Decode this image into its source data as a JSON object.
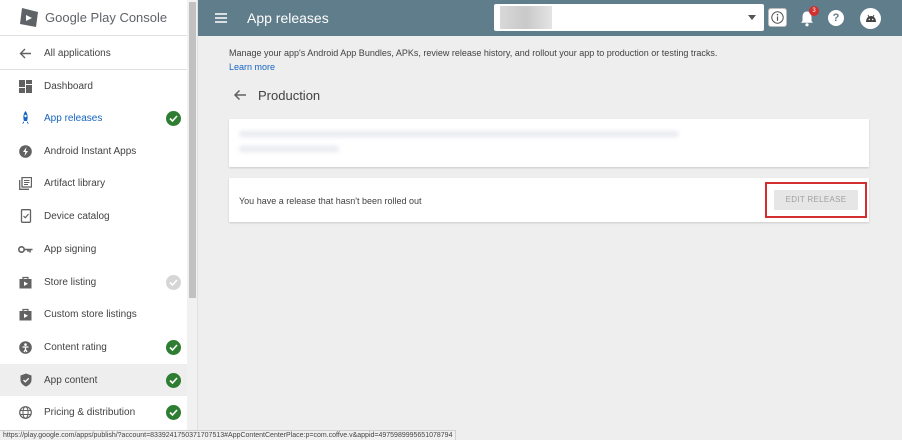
{
  "brand": {
    "name_1": "Google Play",
    "name_2": " Console"
  },
  "nav": {
    "all_applications": "All applications",
    "items": [
      {
        "label": "Dashboard",
        "icon": "dashboard-icon",
        "status": "none"
      },
      {
        "label": "App releases",
        "icon": "rocket-icon",
        "status": "complete",
        "active": true
      },
      {
        "label": "Android Instant Apps",
        "icon": "instant-apps-icon",
        "status": "none"
      },
      {
        "label": "Artifact library",
        "icon": "library-icon",
        "status": "none"
      },
      {
        "label": "Device catalog",
        "icon": "device-icon",
        "status": "none"
      },
      {
        "label": "App signing",
        "icon": "key-icon",
        "status": "none"
      },
      {
        "label": "Store listing",
        "icon": "store-icon",
        "status": "incomplete"
      },
      {
        "label": "Custom store listings",
        "icon": "store-icon",
        "status": "none"
      },
      {
        "label": "Content rating",
        "icon": "rating-icon",
        "status": "complete"
      },
      {
        "label": "App content",
        "icon": "shield-icon",
        "status": "complete"
      },
      {
        "label": "Pricing & distribution",
        "icon": "globe-icon",
        "status": "complete"
      }
    ]
  },
  "topbar": {
    "title": "App releases",
    "notification_count": "3",
    "help_label": "?"
  },
  "main": {
    "description": "Manage your app's Android App Bundles, APKs, review release history, and rollout your app to production or testing tracks.",
    "learn_more": "Learn more",
    "page_title": "Production",
    "release_notice": "You have a release that hasn't been rolled out",
    "edit_release": "EDIT RELEASE"
  },
  "status_url": "https://play.google.com/apps/publish/?account=8339241750371707513#AppContentCenterPlace:p=com.coffve.v&appid=4975989995651078794",
  "colors": {
    "topbar": "#607d8b",
    "accent": "#1565c0",
    "check": "#2e7d32",
    "highlight_frame": "#d32f2f"
  }
}
